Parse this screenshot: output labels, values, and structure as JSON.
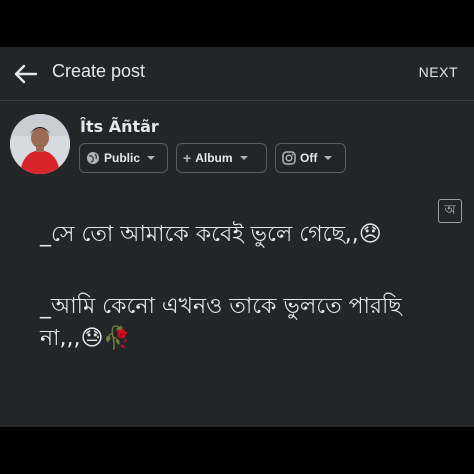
{
  "appbar": {
    "title": "Create post",
    "next_label": "NEXT"
  },
  "profile": {
    "name": "Îts Ãñtãr"
  },
  "chips": {
    "privacy": {
      "label": "Public",
      "icon": "globe-icon"
    },
    "album": {
      "label": "Album",
      "prefix": "+"
    },
    "instagram": {
      "label": "Off",
      "icon": "instagram-icon"
    }
  },
  "lang_button": {
    "glyph": "অ"
  },
  "post": {
    "line1": "_সে তো আমাকে কবেই ভুলে গেছে,,😞",
    "line2": "_আমি কেনো এখনও তাকে ভুলতে পারছি",
    "line3": "না,,,😓🥀"
  },
  "colors": {
    "background": "#242526",
    "text": "#e4e6eb",
    "muted": "#b0b3b8"
  }
}
